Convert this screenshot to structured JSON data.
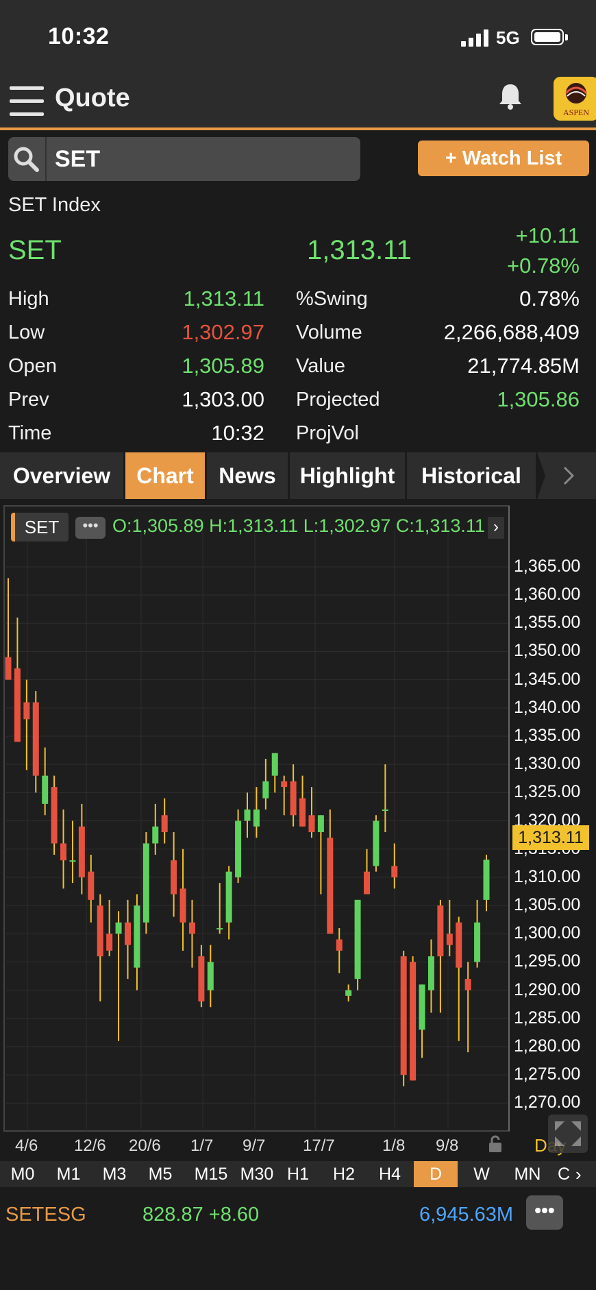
{
  "status_bar": {
    "time": "10:32",
    "network": "5G"
  },
  "header": {
    "title": "Quote",
    "logo_text": "ASPEN",
    "icons": [
      "menu-icon",
      "bell-icon"
    ]
  },
  "search": {
    "value": "SET"
  },
  "watch_button": {
    "label": "+ Watch List"
  },
  "quote": {
    "index_name": "SET Index",
    "symbol": "SET",
    "last": "1,313.11",
    "change": "+10.11",
    "change_pct": "+0.78%",
    "left": [
      {
        "label": "High",
        "value": "1,313.11",
        "color": "#6fe06f"
      },
      {
        "label": "Low",
        "value": "1,302.97",
        "color": "#e5533f"
      },
      {
        "label": "Open",
        "value": "1,305.89",
        "color": "#6fe06f"
      },
      {
        "label": "Prev",
        "value": "1,303.00",
        "color": "#ffffff"
      },
      {
        "label": "Time",
        "value": "10:32",
        "color": "#ffffff"
      }
    ],
    "right": [
      {
        "label": "%Swing",
        "value": "0.78%",
        "color": "#ffffff"
      },
      {
        "label": "Volume",
        "value": "2,266,688,409",
        "color": "#ffffff"
      },
      {
        "label": "Value",
        "value": "21,774.85M",
        "color": "#ffffff"
      },
      {
        "label": "Projected",
        "value": "1,305.86",
        "color": "#6fe06f"
      },
      {
        "label": "ProjVol",
        "value": "",
        "color": "#ffffff"
      }
    ]
  },
  "tabs": [
    "Overview",
    "Chart",
    "News",
    "Highlight",
    "Historical"
  ],
  "active_tab": "Chart",
  "chart_legend": {
    "symbol": "SET",
    "more": "•••",
    "ohlc": "O:1,305.89  H:1,313.11  L:1,302.97  C:1,313.11"
  },
  "chart_data": {
    "type": "candlestick",
    "ylim": [
      1267,
      1369
    ],
    "y_ticks": [
      "1,365.00",
      "1,360.00",
      "1,355.00",
      "1,350.00",
      "1,345.00",
      "1,340.00",
      "1,335.00",
      "1,330.00",
      "1,325.00",
      "1,320.00",
      "1,315.00",
      "1,310.00",
      "1,305.00",
      "1,300.00",
      "1,295.00",
      "1,290.00",
      "1,285.00",
      "1,280.00",
      "1,275.00",
      "1,270.00"
    ],
    "x_ticks": [
      "4/6",
      "12/6",
      "20/6",
      "1/7",
      "9/7",
      "17/7",
      "1/8",
      "9/8"
    ],
    "last_price_label": "1,313.11",
    "up_color": "#5fd15f",
    "down_color": "#e5533f",
    "candles": [
      {
        "o": 1349,
        "h": 1363,
        "l": 1346,
        "c": 1345
      },
      {
        "o": 1347,
        "h": 1356,
        "l": 1336,
        "c": 1334
      },
      {
        "o": 1341,
        "h": 1345,
        "l": 1329,
        "c": 1338
      },
      {
        "o": 1341,
        "h": 1343,
        "l": 1325,
        "c": 1328
      },
      {
        "o": 1323,
        "h": 1333,
        "l": 1321,
        "c": 1328
      },
      {
        "o": 1326,
        "h": 1328,
        "l": 1314,
        "c": 1316
      },
      {
        "o": 1316,
        "h": 1322,
        "l": 1308,
        "c": 1313
      },
      {
        "o": 1313,
        "h": 1320,
        "l": 1309,
        "c": 1313
      },
      {
        "o": 1319,
        "h": 1323,
        "l": 1307,
        "c": 1310
      },
      {
        "o": 1311,
        "h": 1314,
        "l": 1302,
        "c": 1306
      },
      {
        "o": 1305,
        "h": 1307,
        "l": 1288,
        "c": 1296
      },
      {
        "o": 1300,
        "h": 1306,
        "l": 1296,
        "c": 1297
      },
      {
        "o": 1300,
        "h": 1304,
        "l": 1281,
        "c": 1302
      },
      {
        "o": 1302,
        "h": 1306,
        "l": 1292,
        "c": 1298
      },
      {
        "o": 1294,
        "h": 1307,
        "l": 1290,
        "c": 1305
      },
      {
        "o": 1302,
        "h": 1318,
        "l": 1300,
        "c": 1316
      },
      {
        "o": 1316,
        "h": 1323,
        "l": 1314,
        "c": 1319
      },
      {
        "o": 1321,
        "h": 1324,
        "l": 1316,
        "c": 1318
      },
      {
        "o": 1313,
        "h": 1318,
        "l": 1303,
        "c": 1307
      },
      {
        "o": 1308,
        "h": 1315,
        "l": 1297,
        "c": 1302
      },
      {
        "o": 1302,
        "h": 1306,
        "l": 1294,
        "c": 1300
      },
      {
        "o": 1296,
        "h": 1298,
        "l": 1287,
        "c": 1288
      },
      {
        "o": 1290,
        "h": 1298,
        "l": 1287,
        "c": 1295
      },
      {
        "o": 1301,
        "h": 1309,
        "l": 1300,
        "c": 1301
      },
      {
        "o": 1302,
        "h": 1312,
        "l": 1299,
        "c": 1311
      },
      {
        "o": 1310,
        "h": 1322,
        "l": 1309,
        "c": 1320
      },
      {
        "o": 1320,
        "h": 1325,
        "l": 1317,
        "c": 1322
      },
      {
        "o": 1319,
        "h": 1326,
        "l": 1317,
        "c": 1322
      },
      {
        "o": 1324,
        "h": 1331,
        "l": 1322,
        "c": 1327
      },
      {
        "o": 1328,
        "h": 1332,
        "l": 1325,
        "c": 1332
      },
      {
        "o": 1327,
        "h": 1328,
        "l": 1321,
        "c": 1326
      },
      {
        "o": 1327,
        "h": 1330,
        "l": 1319,
        "c": 1321
      },
      {
        "o": 1324,
        "h": 1328,
        "l": 1319,
        "c": 1319
      },
      {
        "o": 1321,
        "h": 1326,
        "l": 1317,
        "c": 1318
      },
      {
        "o": 1318,
        "h": 1321,
        "l": 1307,
        "c": 1321
      },
      {
        "o": 1317,
        "h": 1322,
        "l": 1302,
        "c": 1300
      },
      {
        "o": 1299,
        "h": 1301,
        "l": 1293,
        "c": 1297
      },
      {
        "o": 1289,
        "h": 1291,
        "l": 1288,
        "c": 1290
      },
      {
        "o": 1292,
        "h": 1306,
        "l": 1290,
        "c": 1306
      },
      {
        "o": 1311,
        "h": 1315,
        "l": 1308,
        "c": 1307
      },
      {
        "o": 1312,
        "h": 1321,
        "l": 1311,
        "c": 1320
      },
      {
        "o": 1322,
        "h": 1330,
        "l": 1318,
        "c": 1322
      },
      {
        "o": 1312,
        "h": 1316,
        "l": 1308,
        "c": 1310
      },
      {
        "o": 1296,
        "h": 1297,
        "l": 1273,
        "c": 1275
      },
      {
        "o": 1295,
        "h": 1296,
        "l": 1274,
        "c": 1274
      },
      {
        "o": 1283,
        "h": 1291,
        "l": 1278,
        "c": 1291
      },
      {
        "o": 1290,
        "h": 1299,
        "l": 1286,
        "c": 1296
      },
      {
        "o": 1305,
        "h": 1306,
        "l": 1286,
        "c": 1296
      },
      {
        "o": 1300,
        "h": 1306,
        "l": 1296,
        "c": 1298
      },
      {
        "o": 1302,
        "h": 1303,
        "l": 1281,
        "c": 1294
      },
      {
        "o": 1292,
        "h": 1295,
        "l": 1279,
        "c": 1290
      },
      {
        "o": 1295,
        "h": 1306,
        "l": 1294,
        "c": 1302
      },
      {
        "o": 1306,
        "h": 1314,
        "l": 1304,
        "c": 1313.11
      }
    ]
  },
  "chart_tools": {
    "day_label": "Day"
  },
  "timeframes": [
    "M0",
    "M1",
    "M3",
    "M5",
    "M15",
    "M30",
    "H1",
    "H2",
    "H4",
    "D",
    "W",
    "MN",
    "C"
  ],
  "active_timeframe": "D",
  "ticker": {
    "symbol": "SETESG",
    "price": "828.87 +8.60",
    "value": "6,945.63M",
    "more": "•••"
  }
}
